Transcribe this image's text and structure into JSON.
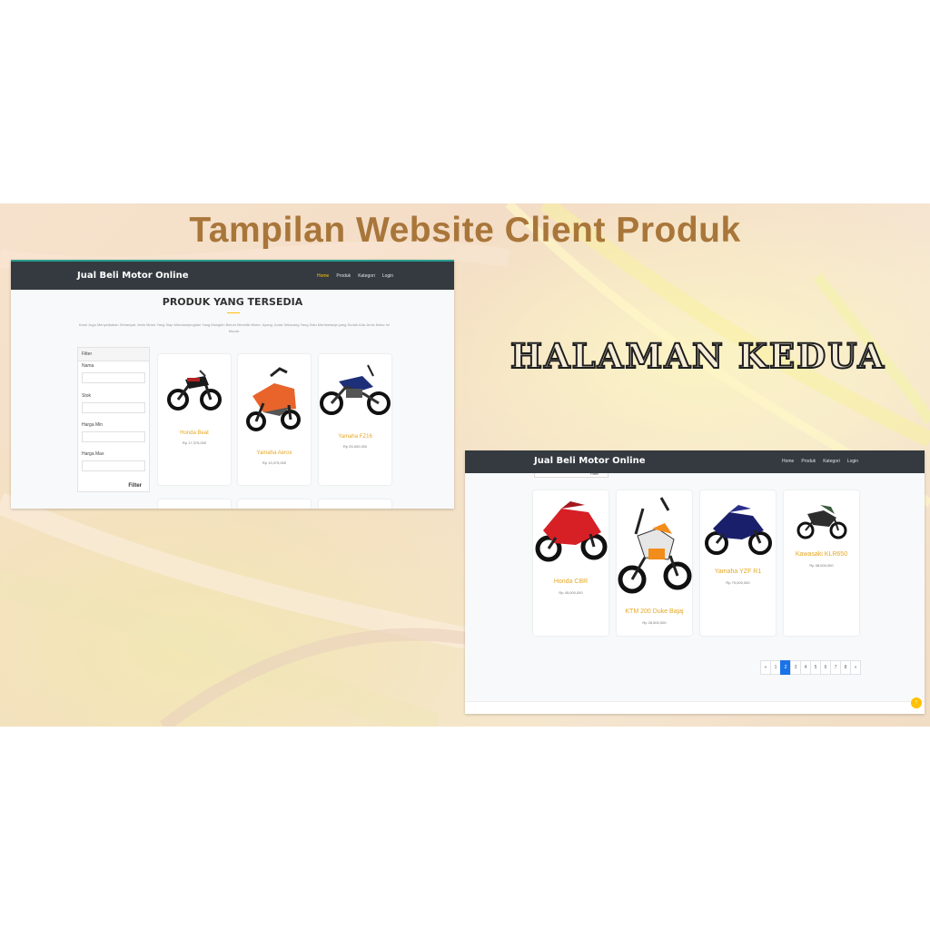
{
  "slide": {
    "title": "Tampilan Website Client Produk",
    "side_title": "HALAMAN KEDUA"
  },
  "page1": {
    "brand": "Jual Beli Motor Online",
    "nav": [
      "Home",
      "Produk",
      "Kategori",
      "Login"
    ],
    "active_nav": "Home",
    "heading": "PRODUK YANG TERSEDIA",
    "intro": "Kami Juga Menyediakan Sebanyak Jenis Motor Yang Siap Mendampingkan Yang Mungkin Belum Memiliki Motor, Ayang, Anda Sekarang Yang Salu Membelanja yang Sudah Ada Jenis Motor Ini Murah.",
    "filter": {
      "title": "Filter",
      "fields": [
        "Nama",
        "Stok",
        "Harga Min",
        "Harga Max"
      ],
      "button": "Filter"
    },
    "products": [
      {
        "name": "Honda Beat",
        "price": "Rp 17,375,000"
      },
      {
        "name": "Yamaha Aerox",
        "price": "Rp 13,375,000"
      },
      {
        "name": "Yamaha FZ16",
        "price": "Rp 25,500,000"
      }
    ]
  },
  "page2": {
    "brand": "Jual Beli Motor Online",
    "nav": [
      "Home",
      "Produk",
      "Kategori",
      "Login"
    ],
    "filter_stub": "Filter",
    "products": [
      {
        "name": "Honda CBR",
        "price": "Rp 45,000,000"
      },
      {
        "name": "KTM 200 Duke Bajaj",
        "price": "Rp 28,500,000"
      },
      {
        "name": "Yamaha YZF R1",
        "price": "Rp 79,000,000"
      },
      {
        "name": "Kawasaki KLR650",
        "price": "Rp 38,000,000"
      }
    ],
    "pagination": [
      "«",
      "1",
      "2",
      "3",
      "4",
      "5",
      "6",
      "7",
      "8",
      "»"
    ],
    "active_page": "2"
  },
  "colors": {
    "title": "#a9763a",
    "navbar": "#343a40",
    "product_name": "#e5a823",
    "pager_active": "#1a73e8",
    "scroll_button": "#ffc107"
  },
  "icons": [
    "motorcycle-image",
    "arrow-up-icon"
  ]
}
